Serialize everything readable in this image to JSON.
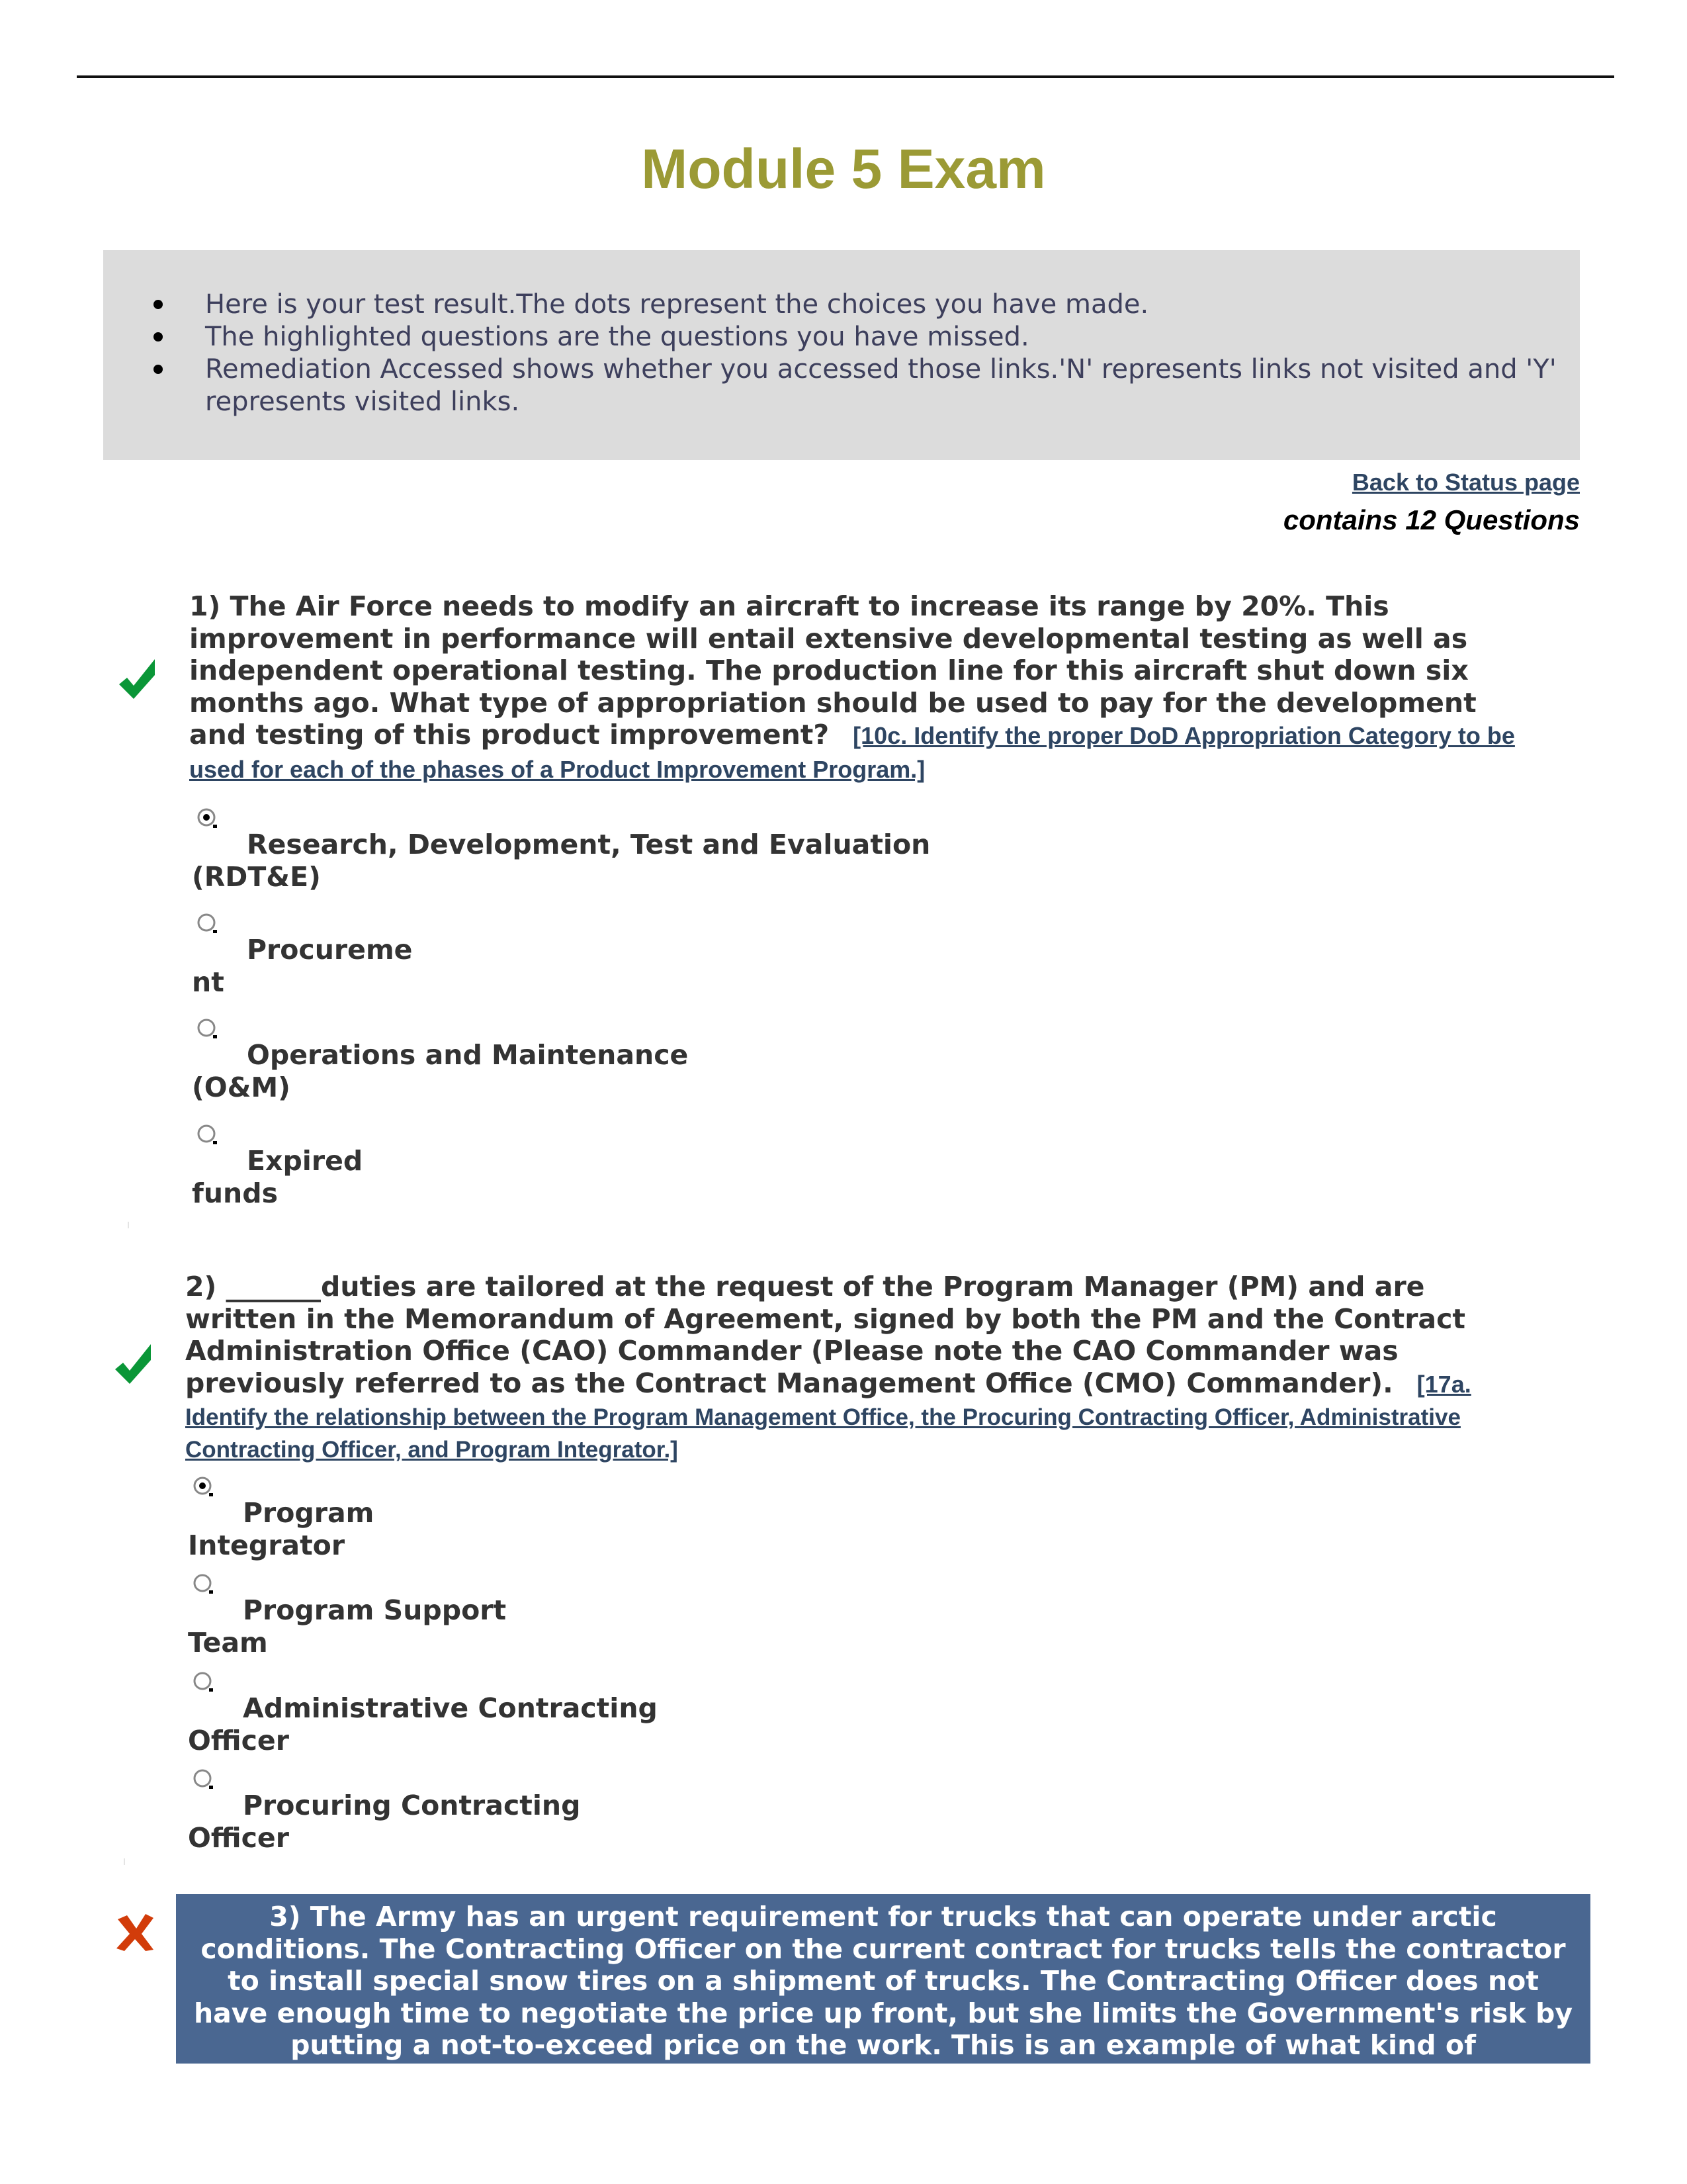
{
  "page": {
    "title": "Module 5 Exam",
    "info_bullets": [
      "Here is your test result.The dots represent the choices you have made.",
      "The highlighted questions are the questions you have missed.",
      "Remediation Accessed shows whether you accessed those links.'N' represents links not visited and 'Y' represents visited links."
    ],
    "back_link": "Back to Status page",
    "question_count": "contains 12 Questions"
  },
  "colors": {
    "title": "#9b9a35",
    "info_background": "#dcdcdc",
    "link": "#2e4562",
    "correct": "#0a9637",
    "incorrect": "#d23c0a",
    "missed_highlight": "#4a6791"
  },
  "questions": [
    {
      "number": "1",
      "status": "correct",
      "status_icon": "checkmark-icon",
      "text": "1) The Air Force needs to modify an aircraft to increase its range by 20%. This improvement in performance will entail extensive developmental testing as well as independent operational testing. The production line for this aircraft shut down six months ago. What type of appropriation should be used to pay for the development and testing of this product improvement?",
      "objective_link": "[10c. Identify the proper DoD Appropriation Category to be used for each of the phases of a Product Improvement Program.]",
      "options": [
        {
          "line1": "Research, Development, Test and Evaluation",
          "line2": "(RDT&E)",
          "selected": true
        },
        {
          "line1": "Procureme",
          "line2": "nt",
          "selected": false
        },
        {
          "line1": "Operations and Maintenance",
          "line2": "(O&M)",
          "selected": false
        },
        {
          "line1": "Expired",
          "line2": "funds",
          "selected": false
        }
      ]
    },
    {
      "number": "2",
      "status": "correct",
      "status_icon": "checkmark-icon",
      "text_lines": [
        "2) _______duties are tailored at the request of the Program Manager (PM) and are",
        "written in the Memorandum of Agreement, signed by both the PM and the Contract",
        "Administration Office (CAO) Commander (Please note the CAO Commander was",
        "previously referred to as the Contract Management Office (CMO) Commander)."
      ],
      "objective_link_parts": [
        "[17a.",
        "Identify the relationship between the Program Management Office, the Procuring Contracting Officer, Administrative",
        "Contracting Officer, and Program Integrator.]"
      ],
      "options": [
        {
          "line1": "Program",
          "line2": "Integrator",
          "selected": true
        },
        {
          "line1": "Program Support",
          "line2": "Team",
          "selected": false
        },
        {
          "line1": "Administrative Contracting",
          "line2": "Officer",
          "selected": false
        },
        {
          "line1": "Procuring Contracting",
          "line2": "Officer",
          "selected": false
        }
      ]
    },
    {
      "number": "3",
      "status": "incorrect",
      "status_icon": "x-mark-icon",
      "text_lines": [
        "3) The Army has an urgent requirement for trucks that can operate under arctic",
        "conditions. The Contracting Officer on the current contract for trucks tells the contractor",
        "to install special snow tires on a shipment of trucks. The Contracting Officer does not",
        "have enough time to negotiate the price up front, but she limits the Government's risk by",
        "putting a not-to-exceed price on the work. This is an example of what kind of"
      ]
    }
  ],
  "q1_text_lines": [
    "1) The Air Force needs to modify an aircraft to increase its range by 20%. This",
    "improvement in performance will entail extensive developmental testing as well as",
    "independent operational testing. The production line for this aircraft shut down six",
    "months ago. What type of appropriation should be used to pay for the development",
    "and testing of this product improvement?"
  ],
  "q1_link_parts": [
    "[10c. Identify the proper DoD Appropriation Category to be",
    "used for each of the phases of a Product Improvement Program.]"
  ]
}
